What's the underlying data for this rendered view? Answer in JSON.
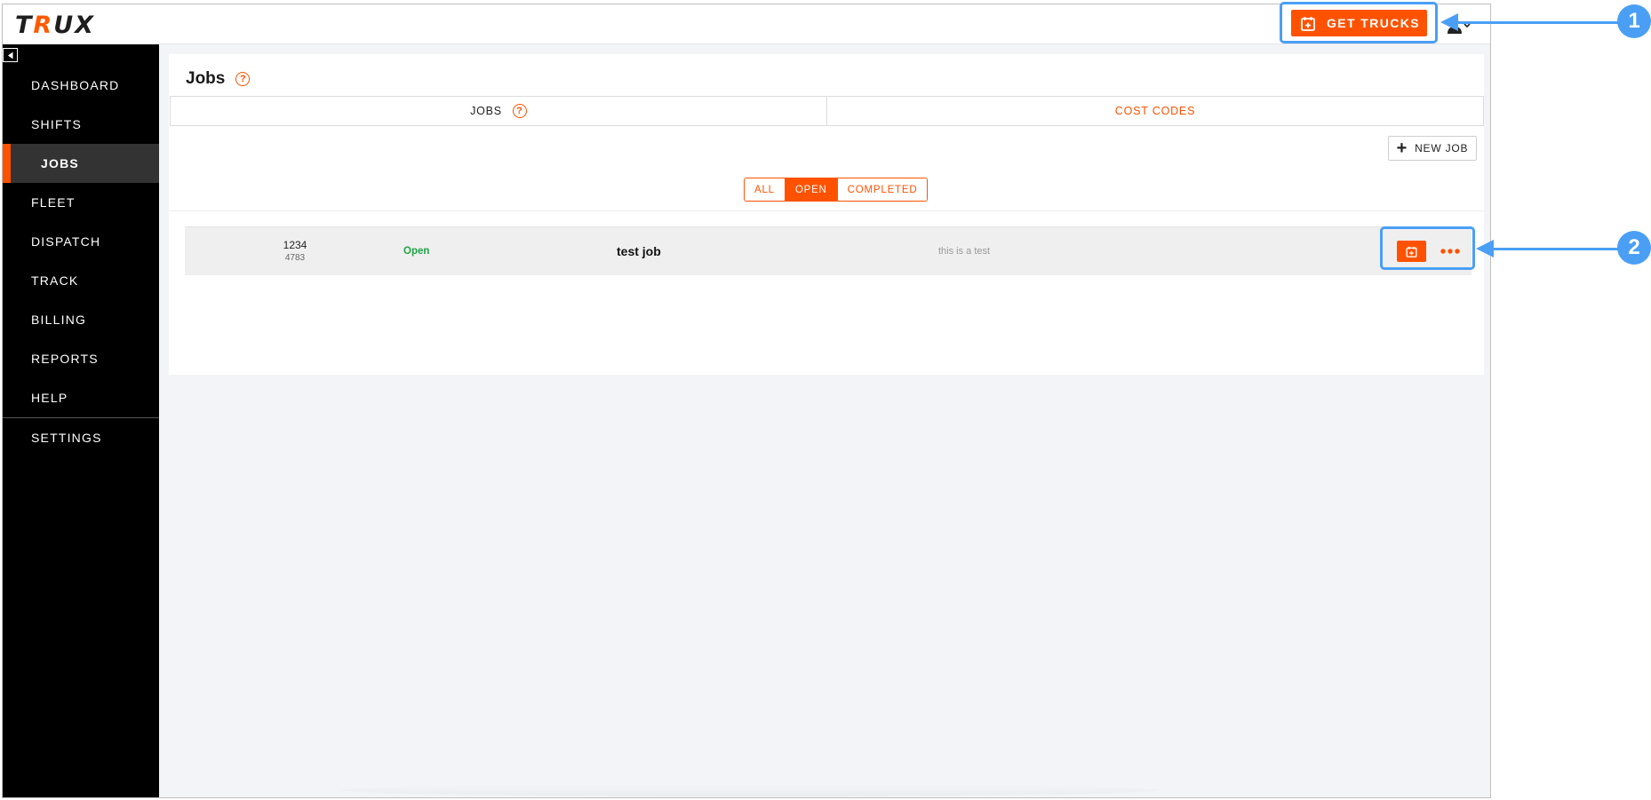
{
  "app": {
    "logo": {
      "text": "TRUX"
    },
    "header": {
      "get_trucks_label": "GET TRUCKS"
    }
  },
  "sidebar": {
    "items": [
      {
        "label": "DASHBOARD",
        "active": false
      },
      {
        "label": "SHIFTS",
        "active": false
      },
      {
        "label": "JOBS",
        "active": true
      },
      {
        "label": "FLEET",
        "active": false
      },
      {
        "label": "DISPATCH",
        "active": false
      },
      {
        "label": "TRACK",
        "active": false
      },
      {
        "label": "BILLING",
        "active": false
      },
      {
        "label": "REPORTS",
        "active": false
      },
      {
        "label": "HELP",
        "active": false
      }
    ],
    "settings_label": "SETTINGS"
  },
  "page": {
    "title": "Jobs",
    "tabs": [
      {
        "label": "JOBS",
        "active": true
      },
      {
        "label": "COST CODES",
        "active": false
      }
    ],
    "new_job_label": "NEW JOB",
    "filters": [
      {
        "label": "ALL",
        "active": false
      },
      {
        "label": "OPEN",
        "active": true
      },
      {
        "label": "COMPLETED",
        "active": false
      }
    ],
    "jobs": [
      {
        "number": "1234",
        "sub_number": "4783",
        "status": "Open",
        "name": "test job",
        "description": "this is a test"
      }
    ]
  },
  "annotations": [
    {
      "label": "1"
    },
    {
      "label": "2"
    }
  ],
  "colors": {
    "brand": "#ff5200",
    "annotation": "#4a9ff5",
    "status_open": "#1ea345"
  },
  "icons": {
    "get_trucks": "calendar-plus-icon",
    "row_schedule": "calendar-plus-icon",
    "row_more": "more-horizontal-icon",
    "help": "question-circle-icon",
    "collapse": "triangle-left-icon",
    "user": "user-icon"
  }
}
